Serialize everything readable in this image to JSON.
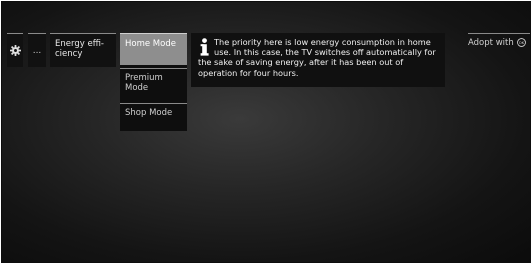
{
  "menu": {
    "dots_label": "...",
    "energy_label": "Energy effi-ciency",
    "energy_line1": "Energy effi-",
    "energy_line2": "ciency",
    "options": [
      {
        "label": "Home Mode",
        "selected": true
      },
      {
        "label": "Premium Mode",
        "line1": "Premium",
        "line2": "Mode",
        "selected": false
      },
      {
        "label": "Shop Mode",
        "selected": false
      }
    ]
  },
  "info": {
    "icon": "info-icon",
    "text": "The priority here is low energy consumption in home use. In this case, the TV switches off automatically for the sake of saving energy, after it has been out of operation for four hours."
  },
  "hint": {
    "adopt_label": "Adopt with",
    "button_icon": "ok-button-icon",
    "button_text": "OK"
  },
  "colors": {
    "selected_bg": "#8e8e8e",
    "panel_bg": "#101010"
  }
}
